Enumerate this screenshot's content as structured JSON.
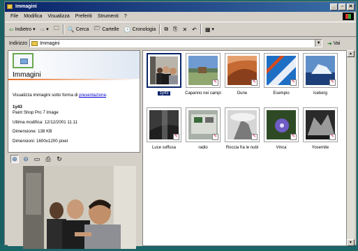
{
  "window": {
    "title": "Immagini"
  },
  "title_buttons": [
    "_",
    "▫",
    "✕"
  ],
  "menu": [
    "File",
    "Modifica",
    "Visualizza",
    "Preferiti",
    "Strumenti",
    "?"
  ],
  "toolbar": {
    "back_label": "Indietro",
    "search_label": "Cerca",
    "folders_label": "Cartelle",
    "history_label": "Cronologia"
  },
  "address": {
    "label": "Indirizzo",
    "value": "Immagini",
    "go_label": "Vai"
  },
  "info_panel": {
    "title": "Immagini",
    "intro": "Visualizza immagini sotto forma di",
    "intro_link": "presentazione",
    "intro_end": ".",
    "file_name": "1y43",
    "file_type": "Paint Shop Pro 7 Image",
    "modified": "Ultima modifica: 12/12/2001 11.11",
    "size": "Dimensione: 138 KB",
    "dimensions": "Dimensioni: 1600x1200 pixel"
  },
  "thumbnails": [
    {
      "label": "1y43",
      "selected": true
    },
    {
      "label": "Capanno nei campi",
      "selected": false
    },
    {
      "label": "Dune",
      "selected": false
    },
    {
      "label": "Esempio",
      "selected": false
    },
    {
      "label": "Iceberg",
      "selected": false
    },
    {
      "label": "Luce soffusa",
      "selected": false
    },
    {
      "label": "radio",
      "selected": false
    },
    {
      "label": "Roccia fra le nubi",
      "selected": false
    },
    {
      "label": "Vinca",
      "selected": false
    },
    {
      "label": "Yosemite",
      "selected": false
    }
  ]
}
